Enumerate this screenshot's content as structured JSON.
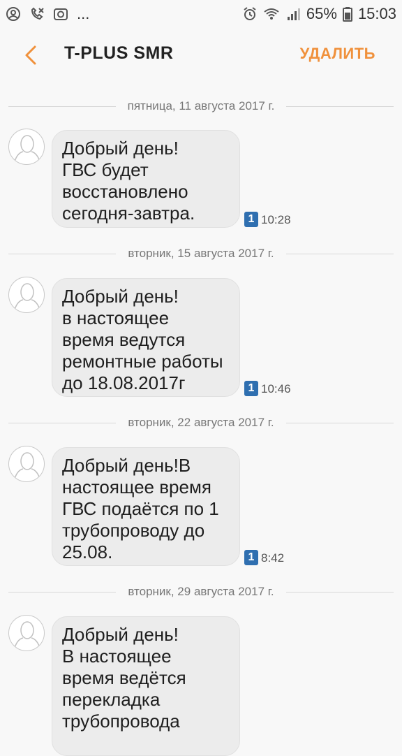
{
  "status_bar": {
    "dots": "...",
    "battery": "65%",
    "time": "15:03"
  },
  "header": {
    "title": "T-PLUS SMR",
    "delete_label": "УДАЛИТЬ"
  },
  "messages": [
    {
      "date": "пятница, 11 августа 2017 г.",
      "text": "Добрый день!\nГВС будет\nвосстановлено\nсегодня-завтра.",
      "sim": "1",
      "time": "10:28"
    },
    {
      "date": "вторник, 15 августа 2017 г.",
      "text": "Добрый день!\nв настоящее\nвремя ведутся\nремонтные работы\nдо 18.08.2017г",
      "sim": "1",
      "time": "10:46"
    },
    {
      "date": "вторник, 22 августа 2017 г.",
      "text": "Добрый день!В\nнастоящее время\nГВС подаётся по 1\nтрубопроводу до\n25.08.",
      "sim": "1",
      "time": "8:42"
    },
    {
      "date": "вторник, 29 августа 2017 г.",
      "text": "Добрый день!\nВ настоящее\nвремя ведётся\nперекладка\nтрубопровода",
      "sim": "",
      "time": ""
    }
  ]
}
